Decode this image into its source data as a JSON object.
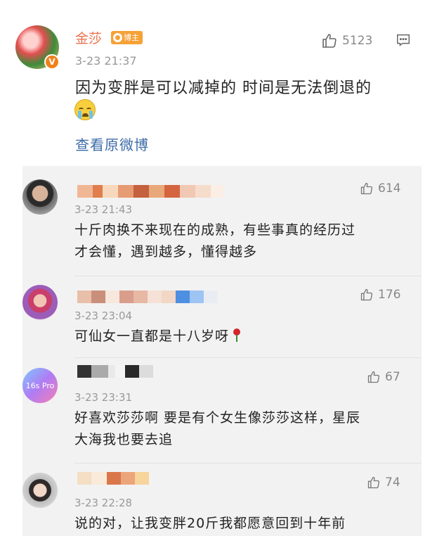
{
  "post": {
    "author": "金莎",
    "author_badge": "博主",
    "verified_mark": "V",
    "time": "3-23 21:37",
    "text": "因为变胖是可以减掉的 时间是无法倒退的",
    "emoji": "crying-face-icon",
    "likes": "5123",
    "view_original": "查看原微博"
  },
  "colors": {
    "author_name": "#eb7350",
    "link": "#3c6ba8",
    "panel_bg": "#f2f2f2",
    "timestamp": "#999999"
  },
  "comments": [
    {
      "time": "3-23 21:43",
      "likes": "614",
      "text_line1": "十斤肉换不来现在的成熟，有些事真的经历过",
      "text_line2": "才会懂，遇到越多，懂得越多",
      "name_blur_colors": [
        "#f0b795",
        "#e07e4d",
        "#f7d8bc",
        "#e79b73",
        "#c4613e",
        "#e9a879",
        "#d4653f",
        "#f1c8b3",
        "#f6dccb",
        "#fbeee4"
      ]
    },
    {
      "time": "3-23 23:04",
      "likes": "176",
      "text": "可仙女一直都是十八岁呀",
      "text_emoji": "rose-icon",
      "name_blur_colors": [
        "#e8bfa8",
        "#c98f7a",
        "#f7e7dd",
        "#d89e8b",
        "#e7b8a3",
        "#f5e1d5",
        "#f2d7c6",
        "#4d8fe0",
        "#9dc4f2",
        "#e9edf3"
      ]
    },
    {
      "time": "3-23 23:31",
      "likes": "67",
      "text_line1": "好喜欢莎莎啊 要是有个女生像莎莎这样，星辰",
      "text_line2": "大海我也要去追",
      "avatar_text": "16s Pro",
      "name_blur_colors": [
        "#333333",
        "#aaaaaa",
        "#e9e9e9",
        "#f4f4f4",
        "#2a2a2a",
        "#dcdcdc"
      ]
    },
    {
      "time": "3-23 22:28",
      "likes": "74",
      "text": "说的对，让我变胖20斤我都愿意回到十年前",
      "name_blur_colors": [
        "#f4dec4",
        "#f9ead9",
        "#d9774b",
        "#eca57b",
        "#f6d49c"
      ]
    }
  ]
}
